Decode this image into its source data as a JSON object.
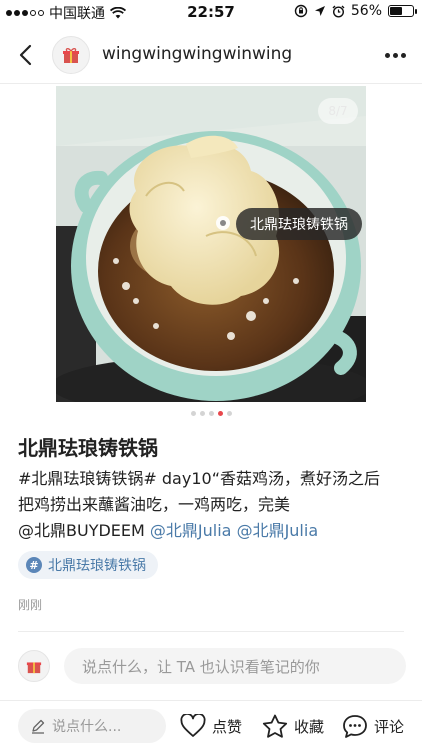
{
  "status_bar": {
    "carrier": "中国联通",
    "time": "22:57",
    "battery": "56%",
    "battery_level": 0.56
  },
  "header": {
    "username": "wingwingwingwinwing",
    "back_icon": "chevron-left-icon",
    "more_icon": "more-horizontal-icon"
  },
  "photo": {
    "counter": "8/7",
    "tag_label": "北鼎珐琅铸铁锅"
  },
  "pagination": {
    "total": 5,
    "active_index": 3
  },
  "post": {
    "title": "北鼎珐琅铸铁锅",
    "body_line1": "#北鼎珐琅铸铁锅# day10“香菇鸡汤，煮好汤之后",
    "body_line2": "把鸡捞出来蘸酱油吃，一鸡两吃，完美",
    "body_mention_1": "@北鼎BUYDEEM",
    "body_mention_2": "@北鼎Julia",
    "body_mention_3": "@北鼎Julia",
    "topic": "北鼎珐琅铸铁锅",
    "date": "刚刚"
  },
  "comment": {
    "placeholder": "说点什么，让 TA 也认识看笔记的你"
  },
  "bottom_bar": {
    "input_placeholder": "说点什么...",
    "like_label": "点赞",
    "fav_label": "收藏",
    "comment_label": "评论"
  },
  "colors": {
    "accent_red": "#e8474c",
    "link_blue": "#4a7aa8"
  }
}
